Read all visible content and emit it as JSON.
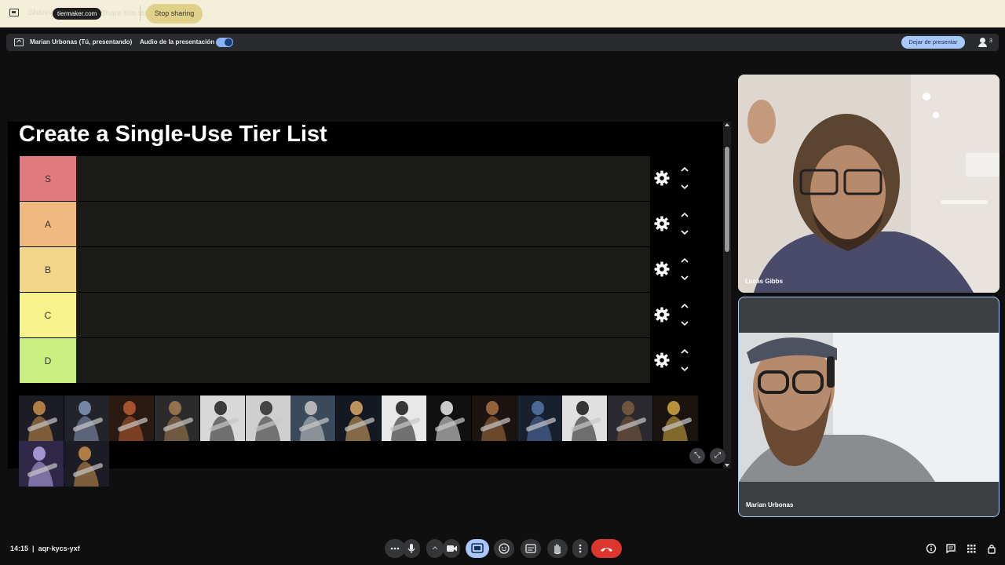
{
  "share_bar": {
    "sharing_tab_text": "Sharing this tab to",
    "site_pill": "tiermaker.com",
    "switch_text": "Share this tab instead",
    "stop_sharing_label": "Stop sharing"
  },
  "presentation_bar": {
    "presenter_label": "Marian Urbonas (Tú, presentando)",
    "audio_label": "Audio de la presentación",
    "audio_toggle_on": true,
    "stop_presenting_label": "Dejar de presentar",
    "participant_count": "3"
  },
  "tier_list": {
    "title": "Create a Single-Use Tier List",
    "tiers": [
      {
        "label": "S",
        "color": "#e07a7f"
      },
      {
        "label": "A",
        "color": "#f0b97f"
      },
      {
        "label": "B",
        "color": "#f3d588"
      },
      {
        "label": "C",
        "color": "#f7f38a"
      },
      {
        "label": "D",
        "color": "#c8ef7f"
      }
    ],
    "tray_item_count": 17
  },
  "participants": [
    {
      "name": "Lucas Gibbs"
    },
    {
      "name": "Marian Urbonas"
    }
  ],
  "bottom_bar": {
    "time": "14:15",
    "separator": "|",
    "meeting_code": "aqr-kycs-yxf"
  },
  "colors": {
    "accent": "#a8c7fa",
    "end_call": "#dc362e",
    "share_active": "#a8c7fa"
  }
}
